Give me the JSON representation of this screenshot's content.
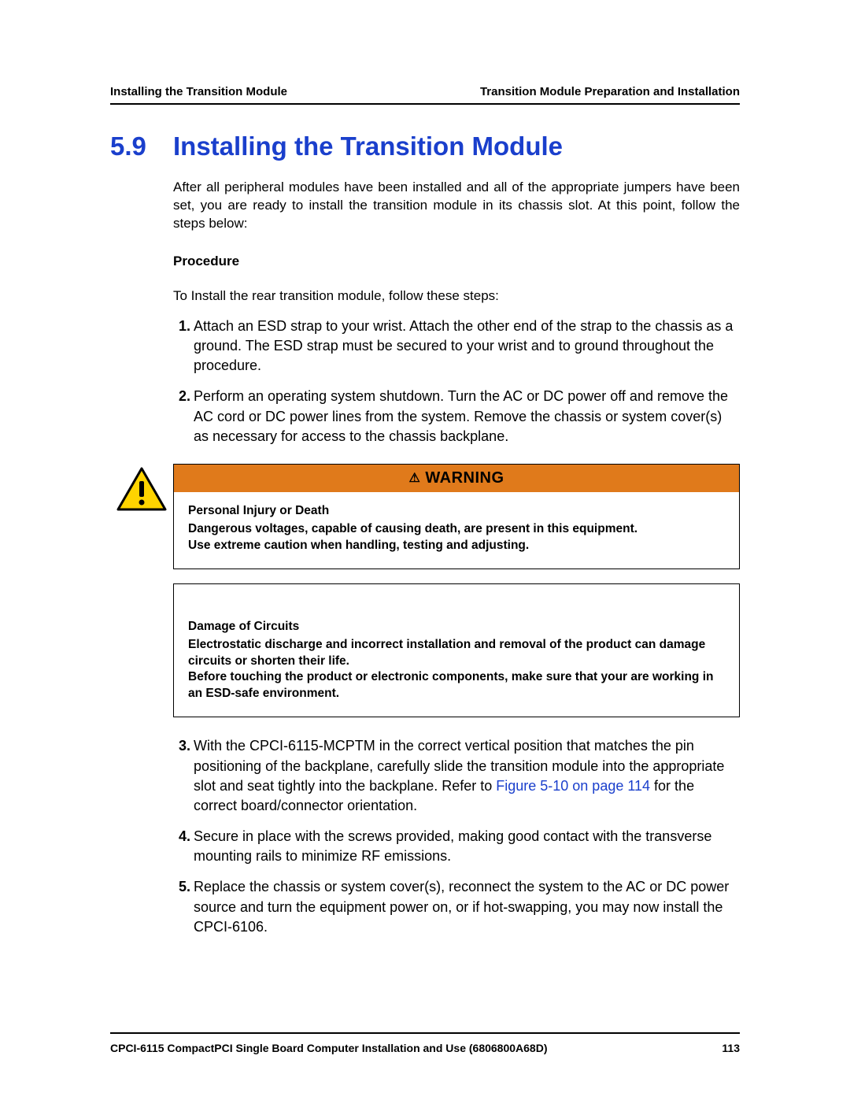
{
  "header": {
    "left": "Installing the Transition Module",
    "right": "Transition Module Preparation and Installation"
  },
  "section": {
    "number": "5.9",
    "title": "Installing the Transition Module"
  },
  "intro": "After all peripheral modules have been installed and all of the appropriate jumpers have been set, you are ready to install the transition module in its chassis slot. At this point, follow the steps below:",
  "procedure": {
    "label": "Procedure",
    "intro": "To Install the rear transition module, follow these steps:",
    "steps_a": [
      "Attach an ESD strap to your wrist. Attach the other end of the strap to the chassis as a ground. The ESD strap must be secured to your wrist and to ground throughout the procedure.",
      "Perform an operating system shutdown. Turn the AC or DC power off and remove the AC cord or DC power lines from the system. Remove the chassis or system cover(s) as necessary for access to the chassis backplane."
    ],
    "step3": {
      "before": "With the CPCI-6115-MCPTM in the correct vertical position that matches the pin positioning of the backplane, carefully slide the transition module into the appropriate slot and seat tightly into the backplane. Refer to ",
      "link": "Figure 5-10 on page 114",
      "after": " for the correct board/connector orientation."
    },
    "steps_b": [
      "Secure in place with the screws provided, making good contact with the transverse mounting rails to minimize RF emissions.",
      "Replace the chassis or system cover(s), reconnect the system to the AC or DC power source and turn the equipment power on, or if hot-swapping, you may now install the CPCI-6106."
    ]
  },
  "warning": {
    "banner": "WARNING",
    "lead": "Personal Injury or Death",
    "line1": "Dangerous voltages, capable of causing death, are present in this equipment.",
    "line2": "Use extreme caution when handling, testing and adjusting."
  },
  "notice": {
    "lead": "Damage of Circuits",
    "line1": "Electrostatic discharge and incorrect installation and removal of the product can damage circuits or shorten their life.",
    "line2": "Before touching the product or electronic components, make sure that your are working in an ESD-safe environment."
  },
  "footer": {
    "doc": "CPCI-6115 CompactPCI Single Board Computer Installation and Use (6806800A68D)",
    "page": "113"
  }
}
